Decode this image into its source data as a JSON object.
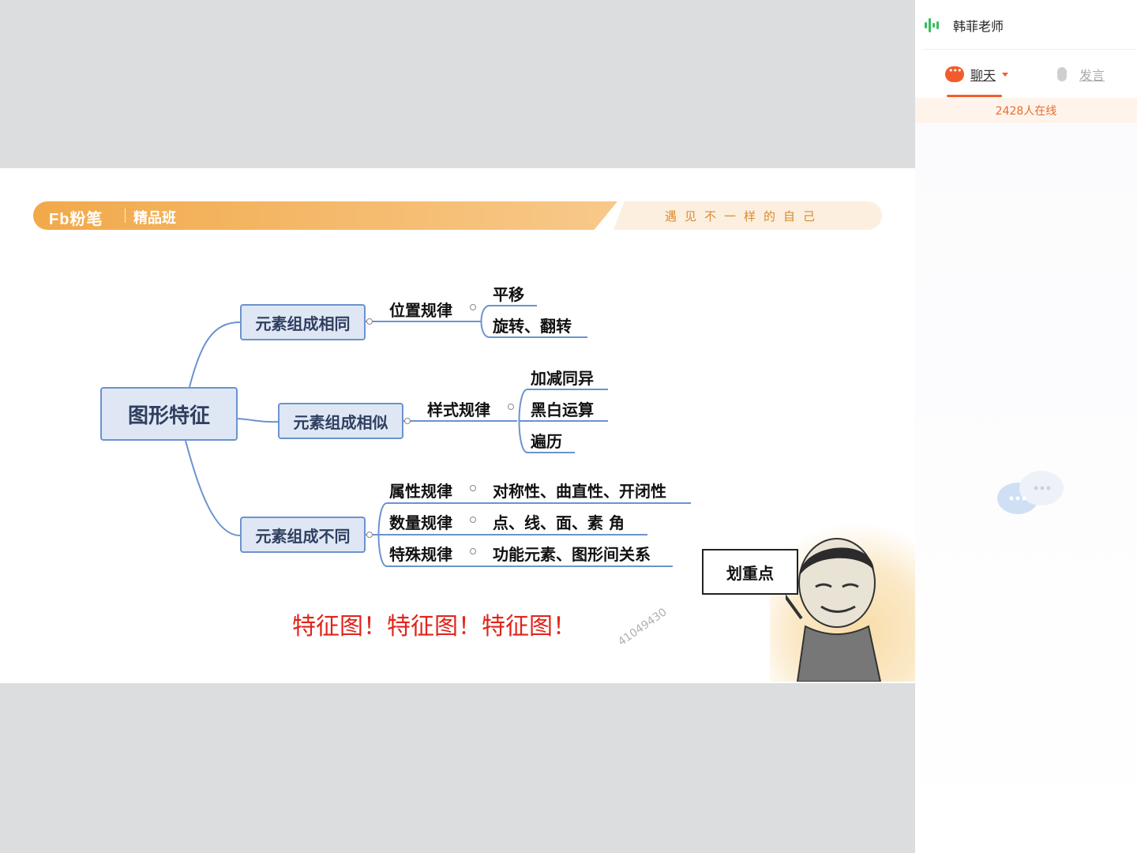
{
  "slide": {
    "brand_logo": "Fb粉笔",
    "brand_class": "精品班",
    "slogan": "遇见不一样的自己",
    "mindmap": {
      "root": "图形特征",
      "branches": [
        {
          "label": "元素组成相同",
          "rules": [
            {
              "name": "位置规律",
              "items": [
                "平移",
                "旋转、翻转"
              ]
            }
          ]
        },
        {
          "label": "元素组成相似",
          "rules": [
            {
              "name": "样式规律",
              "items": [
                "加减同异",
                "黑白运算",
                "遍历"
              ]
            }
          ]
        },
        {
          "label": "元素组成不同",
          "rules": [
            {
              "name": "属性规律",
              "items": [
                "对称性、曲直性、开闭性"
              ]
            },
            {
              "name": "数量规律",
              "items": [
                "点、线、面、素 角"
              ]
            },
            {
              "name": "特殊规律",
              "items": [
                "功能元素、图形间关系"
              ]
            }
          ]
        }
      ]
    },
    "emphasis": "特征图！特征图！特征图！",
    "watermark": "41049430",
    "meme_sign": "划重点"
  },
  "sidebar": {
    "teacher_name": "韩菲老师",
    "tab_chat": "聊天",
    "tab_speak": "发言",
    "online_count": "2428人在线"
  },
  "colors": {
    "accent": "#f25c2c",
    "node_border": "#6b93cf",
    "node_fill": "#dfe7f5",
    "emphasis": "#e0241b",
    "banner": "#f1a94a"
  }
}
